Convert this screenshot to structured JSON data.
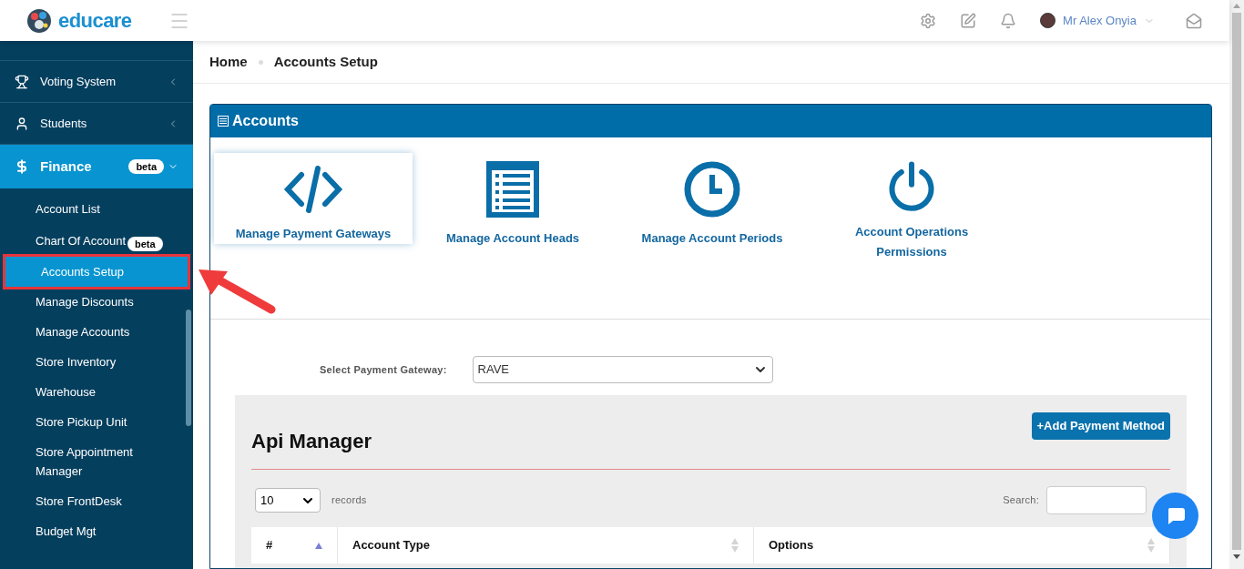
{
  "header": {
    "brand": "educare",
    "user": "Mr Alex Onyia"
  },
  "sidebar": {
    "groups": [
      {
        "label": "Voting System",
        "kind": "trophy",
        "expanded": false
      },
      {
        "label": "Students",
        "kind": "user",
        "expanded": false
      },
      {
        "label": "Finance",
        "kind": "dollar",
        "badge": "beta",
        "expanded": true,
        "children": [
          {
            "label": "Account List",
            "selected": false,
            "highlighted": false
          },
          {
            "label": "Chart Of Account",
            "badge": "beta",
            "selected": false,
            "highlighted": false
          },
          {
            "label": "Accounts Setup",
            "selected": true,
            "highlighted": true
          },
          {
            "label": "Manage Discounts",
            "selected": false,
            "highlighted": false
          },
          {
            "label": "Manage Accounts",
            "selected": false,
            "highlighted": false
          },
          {
            "label": "Store Inventory",
            "selected": false,
            "highlighted": false
          },
          {
            "label": "Warehouse",
            "selected": false,
            "highlighted": false
          },
          {
            "label": "Store Pickup Unit",
            "selected": false,
            "highlighted": false
          },
          {
            "label": "Store Appointment Manager",
            "selected": false,
            "highlighted": false
          },
          {
            "label": "Store FrontDesk",
            "selected": false,
            "highlighted": false
          },
          {
            "label": "Budget Mgt",
            "selected": false,
            "highlighted": false
          }
        ]
      }
    ]
  },
  "breadcrumb": [
    "Home",
    "Accounts Setup"
  ],
  "panel": {
    "title": "Accounts",
    "tiles": [
      {
        "label": "Manage Payment Gateways",
        "kind": "code",
        "selected": true
      },
      {
        "label": "Manage Account Heads",
        "kind": "list",
        "selected": false
      },
      {
        "label": "Manage Account Periods",
        "kind": "clock",
        "selected": false
      },
      {
        "label": "Account Operations Permissions",
        "kind": "power",
        "selected": false
      }
    ]
  },
  "gateway": {
    "label": "Select Payment Gateway:",
    "value": "RAVE"
  },
  "api_manager": {
    "title": "Api Manager",
    "add_button": "+Add Payment Method",
    "page_size": "10",
    "records_label": "records",
    "search_label": "Search:",
    "columns": [
      {
        "label": "#",
        "sorted": true
      },
      {
        "label": "Account Type",
        "sorted": false
      },
      {
        "label": "Options",
        "sorted": false
      }
    ]
  }
}
